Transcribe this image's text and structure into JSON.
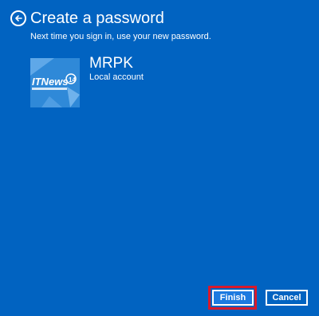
{
  "header": {
    "title": "Create a password",
    "subtitle": "Next time you sign in, use your new password."
  },
  "account": {
    "username": "MRPK",
    "type": "Local account",
    "avatar_logo_text": "ITNews",
    "avatar_logo_number": "14"
  },
  "buttons": {
    "finish_label": "Finish",
    "cancel_label": "Cancel"
  },
  "icons": {
    "back": "arrow-left-circle-icon"
  },
  "colors": {
    "background": "#0163c1",
    "avatar_bg": "#2f89d8",
    "primary_button": "#1c7ae0",
    "highlight": "#d8192b",
    "text": "#ffffff"
  }
}
